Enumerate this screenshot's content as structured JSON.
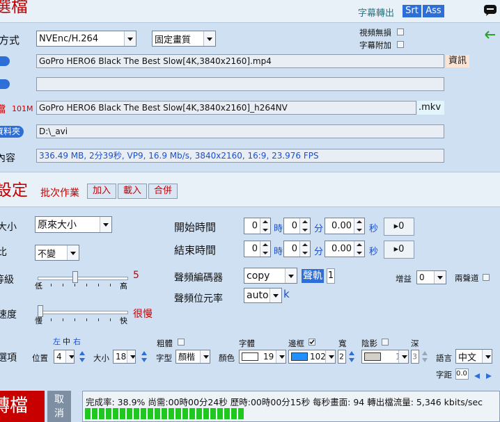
{
  "header": {
    "title": "選檔",
    "subtitle_label": "字幕轉出",
    "subtitle_formats": [
      "Srt",
      "Ass"
    ],
    "icon": "chat-bubble-icon"
  },
  "file": {
    "method_label": "方式",
    "encoder": "NVEnc/H.264",
    "quality_mode": "固定畫質",
    "video_lossless_label": "視頻無損",
    "subtitle_attach_label": "字幕附加",
    "source_file": "GoPro HERO6 Black The Best Slow[4K,3840x2160].mp4",
    "info_button": "資訊",
    "second_file": "",
    "output_size": "101M",
    "output_file": "GoPro HERO6 Black The Best Slow[4K,3840x2160]_h264NV",
    "output_ext": ".mkv",
    "folder_label": "資料夾",
    "folder": "D:\\_avi",
    "content_label": "內容",
    "content": "336.49 MB, 2分39秒, VP9, 16.9 Mb/s, 3840x2160, 16:9, 23.976 FPS",
    "back_icon": "arrow-left-icon"
  },
  "settings": {
    "title": "設定",
    "batch_label": "批次作業",
    "batch_buttons": [
      "加入",
      "載入",
      "合併"
    ],
    "size_label": "大小",
    "size_value": "原來大小",
    "ratio_label": "比",
    "ratio_value": "不變",
    "grade_label": "等級",
    "grade_value": "5",
    "grade_level": 0.42,
    "grade_low": "低",
    "grade_high": "高",
    "speed_label": "速度",
    "speed_value": "很慢",
    "speed_level": 0.0,
    "speed_low": "慢",
    "speed_high": "快",
    "start_label": "開始時間",
    "end_label": "結束時間",
    "hour_unit": "時",
    "min_unit": "分",
    "sec_unit": "秒",
    "start_h": "0",
    "start_m": "0",
    "start_s": "0.00",
    "end_h": "0",
    "end_m": "0",
    "end_s": "0.00",
    "set_button": "▸0",
    "audio_codec_label": "聲頻編碼器",
    "audio_codec": "copy",
    "audio_track_label": "聲軌",
    "audio_track": "1",
    "gain_label": "增益",
    "gain_value": "0",
    "dual_channel_label": "兩聲道",
    "audio_bitrate_label": "聲頻位元率",
    "audio_bitrate": "auto",
    "audio_bitrate_unit": "k"
  },
  "subtitle": {
    "options_label": "選項",
    "align_labels": [
      "左",
      "中",
      "右"
    ],
    "position_label": "位置",
    "position_value": "4",
    "size_label": "大小",
    "size_value": "18",
    "bold_label": "粗體",
    "font_label": "字型",
    "font_value": "顏楷",
    "font_face_label": "字體",
    "color_label": "顏色",
    "color_value": "19",
    "border_label": "邊框",
    "border_value": "102",
    "width_label": "寬",
    "width_value": "2",
    "shadow_label": "陰影",
    "shadow_value": "1",
    "depth_label": "深",
    "depth_value": "3",
    "language_label": "語言",
    "language_value": "中文",
    "spacing_label": "字距",
    "spacing_value": "0.0",
    "text_color": "#ffffff",
    "border_color": "#1e90ff"
  },
  "footer": {
    "convert_button": "轉檔",
    "cancel_button": "取消",
    "status": "完成率: 38.9% 尚需:00時00分24秒 歷時:00時00分15秒 每秒畫面: 94 轉出檔流量: 5,346 kbits/sec",
    "progress": 0.389
  },
  "colors": {
    "accent": "#2d6fd6",
    "title_red": "#c40000",
    "convert_red": "#c80000",
    "progress_green": "#1ec81e"
  }
}
